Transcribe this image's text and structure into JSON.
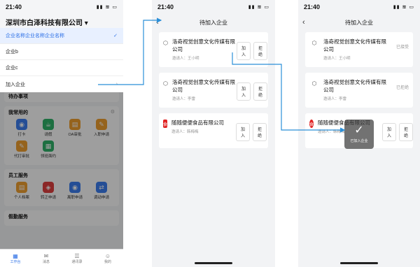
{
  "screen1": {
    "status": {
      "time": "21:40",
      "icons": "▮▮ ≋ ▭"
    },
    "company_title": "深圳市白泽科技有限公司 ▾",
    "dropdown": [
      {
        "label": "企业名称企业名称企业名称",
        "check": "✓"
      },
      {
        "label": "企业b"
      },
      {
        "label": "企业c"
      },
      {
        "label": "加入企业",
        "chevron": "›"
      }
    ],
    "pending_label": "待办事项",
    "sections": [
      {
        "title": "我常用的",
        "more": "⚙",
        "apps": [
          {
            "label": "打卡",
            "icon": "◉",
            "color": "#3c7ff0"
          },
          {
            "label": "请假",
            "icon": "☕",
            "color": "#2fb36a"
          },
          {
            "label": "OA审批",
            "icon": "▤",
            "color": "#f0a030"
          },
          {
            "label": "入职申请",
            "icon": "✎",
            "color": "#f0a030"
          },
          {
            "label": "代打审批",
            "icon": "✎",
            "color": "#f0a030"
          },
          {
            "label": "领班面约",
            "icon": "▦",
            "color": "#2fb36a"
          }
        ]
      },
      {
        "title": "员工服务",
        "more": "",
        "apps": [
          {
            "label": "个人档案",
            "icon": "▤",
            "color": "#f0a030"
          },
          {
            "label": "转正申请",
            "icon": "◈",
            "color": "#e04040"
          },
          {
            "label": "离职申请",
            "icon": "◉",
            "color": "#3c7ff0"
          },
          {
            "label": "调动申请",
            "icon": "⇄",
            "color": "#3c7ff0"
          }
        ]
      },
      {
        "title": "假勤服务",
        "more": "",
        "apps": []
      }
    ],
    "tabs": [
      {
        "label": "工作台",
        "icon": "▦"
      },
      {
        "label": "消息",
        "icon": "✉"
      },
      {
        "label": "通讯录",
        "icon": "☰"
      },
      {
        "label": "我的",
        "icon": "☺"
      }
    ]
  },
  "screen2": {
    "status": {
      "time": "21:40",
      "icons": "▮▮ ≋ ▭"
    },
    "back": "‹",
    "title": "待加入企业",
    "cards": [
      {
        "name": "洛奇视觉创意文化传媒有限公司",
        "inviter": "邀请人：王小明",
        "logo": "⬡",
        "accept": "加入",
        "reject": "拒绝"
      },
      {
        "name": "洛奇视觉创意文化传媒有限公司",
        "inviter": "邀请人：李雷",
        "logo": "⬡",
        "accept": "加入",
        "reject": "拒绝"
      },
      {
        "name": "随随便便食品有限公司",
        "inviter": "邀请人：韩梅梅",
        "logo": "食",
        "accept": "加入",
        "reject": "拒绝"
      }
    ]
  },
  "screen3": {
    "status": {
      "time": "21:40",
      "icons": "▮▮ ≋ ▭"
    },
    "back": "‹",
    "title": "待加入企业",
    "cards": [
      {
        "name": "洛奇视觉创意文化传媒有限公司",
        "inviter": "邀请人：王小明",
        "logo": "⬡",
        "state": "已接受"
      },
      {
        "name": "洛奇视觉创意文化传媒有限公司",
        "inviter": "邀请人：李雷",
        "logo": "⬡",
        "state": "已拒绝"
      },
      {
        "name": "随随便便食品有限公司",
        "inviter": "邀请人：韩梅梅",
        "logo": "食",
        "accept": "加入",
        "reject": "拒绝"
      }
    ],
    "toast": {
      "icon": "✓",
      "text": "已加入企业"
    }
  },
  "colors": {
    "accent": "#2b6fe6",
    "arrow": "#2b8fd8"
  }
}
